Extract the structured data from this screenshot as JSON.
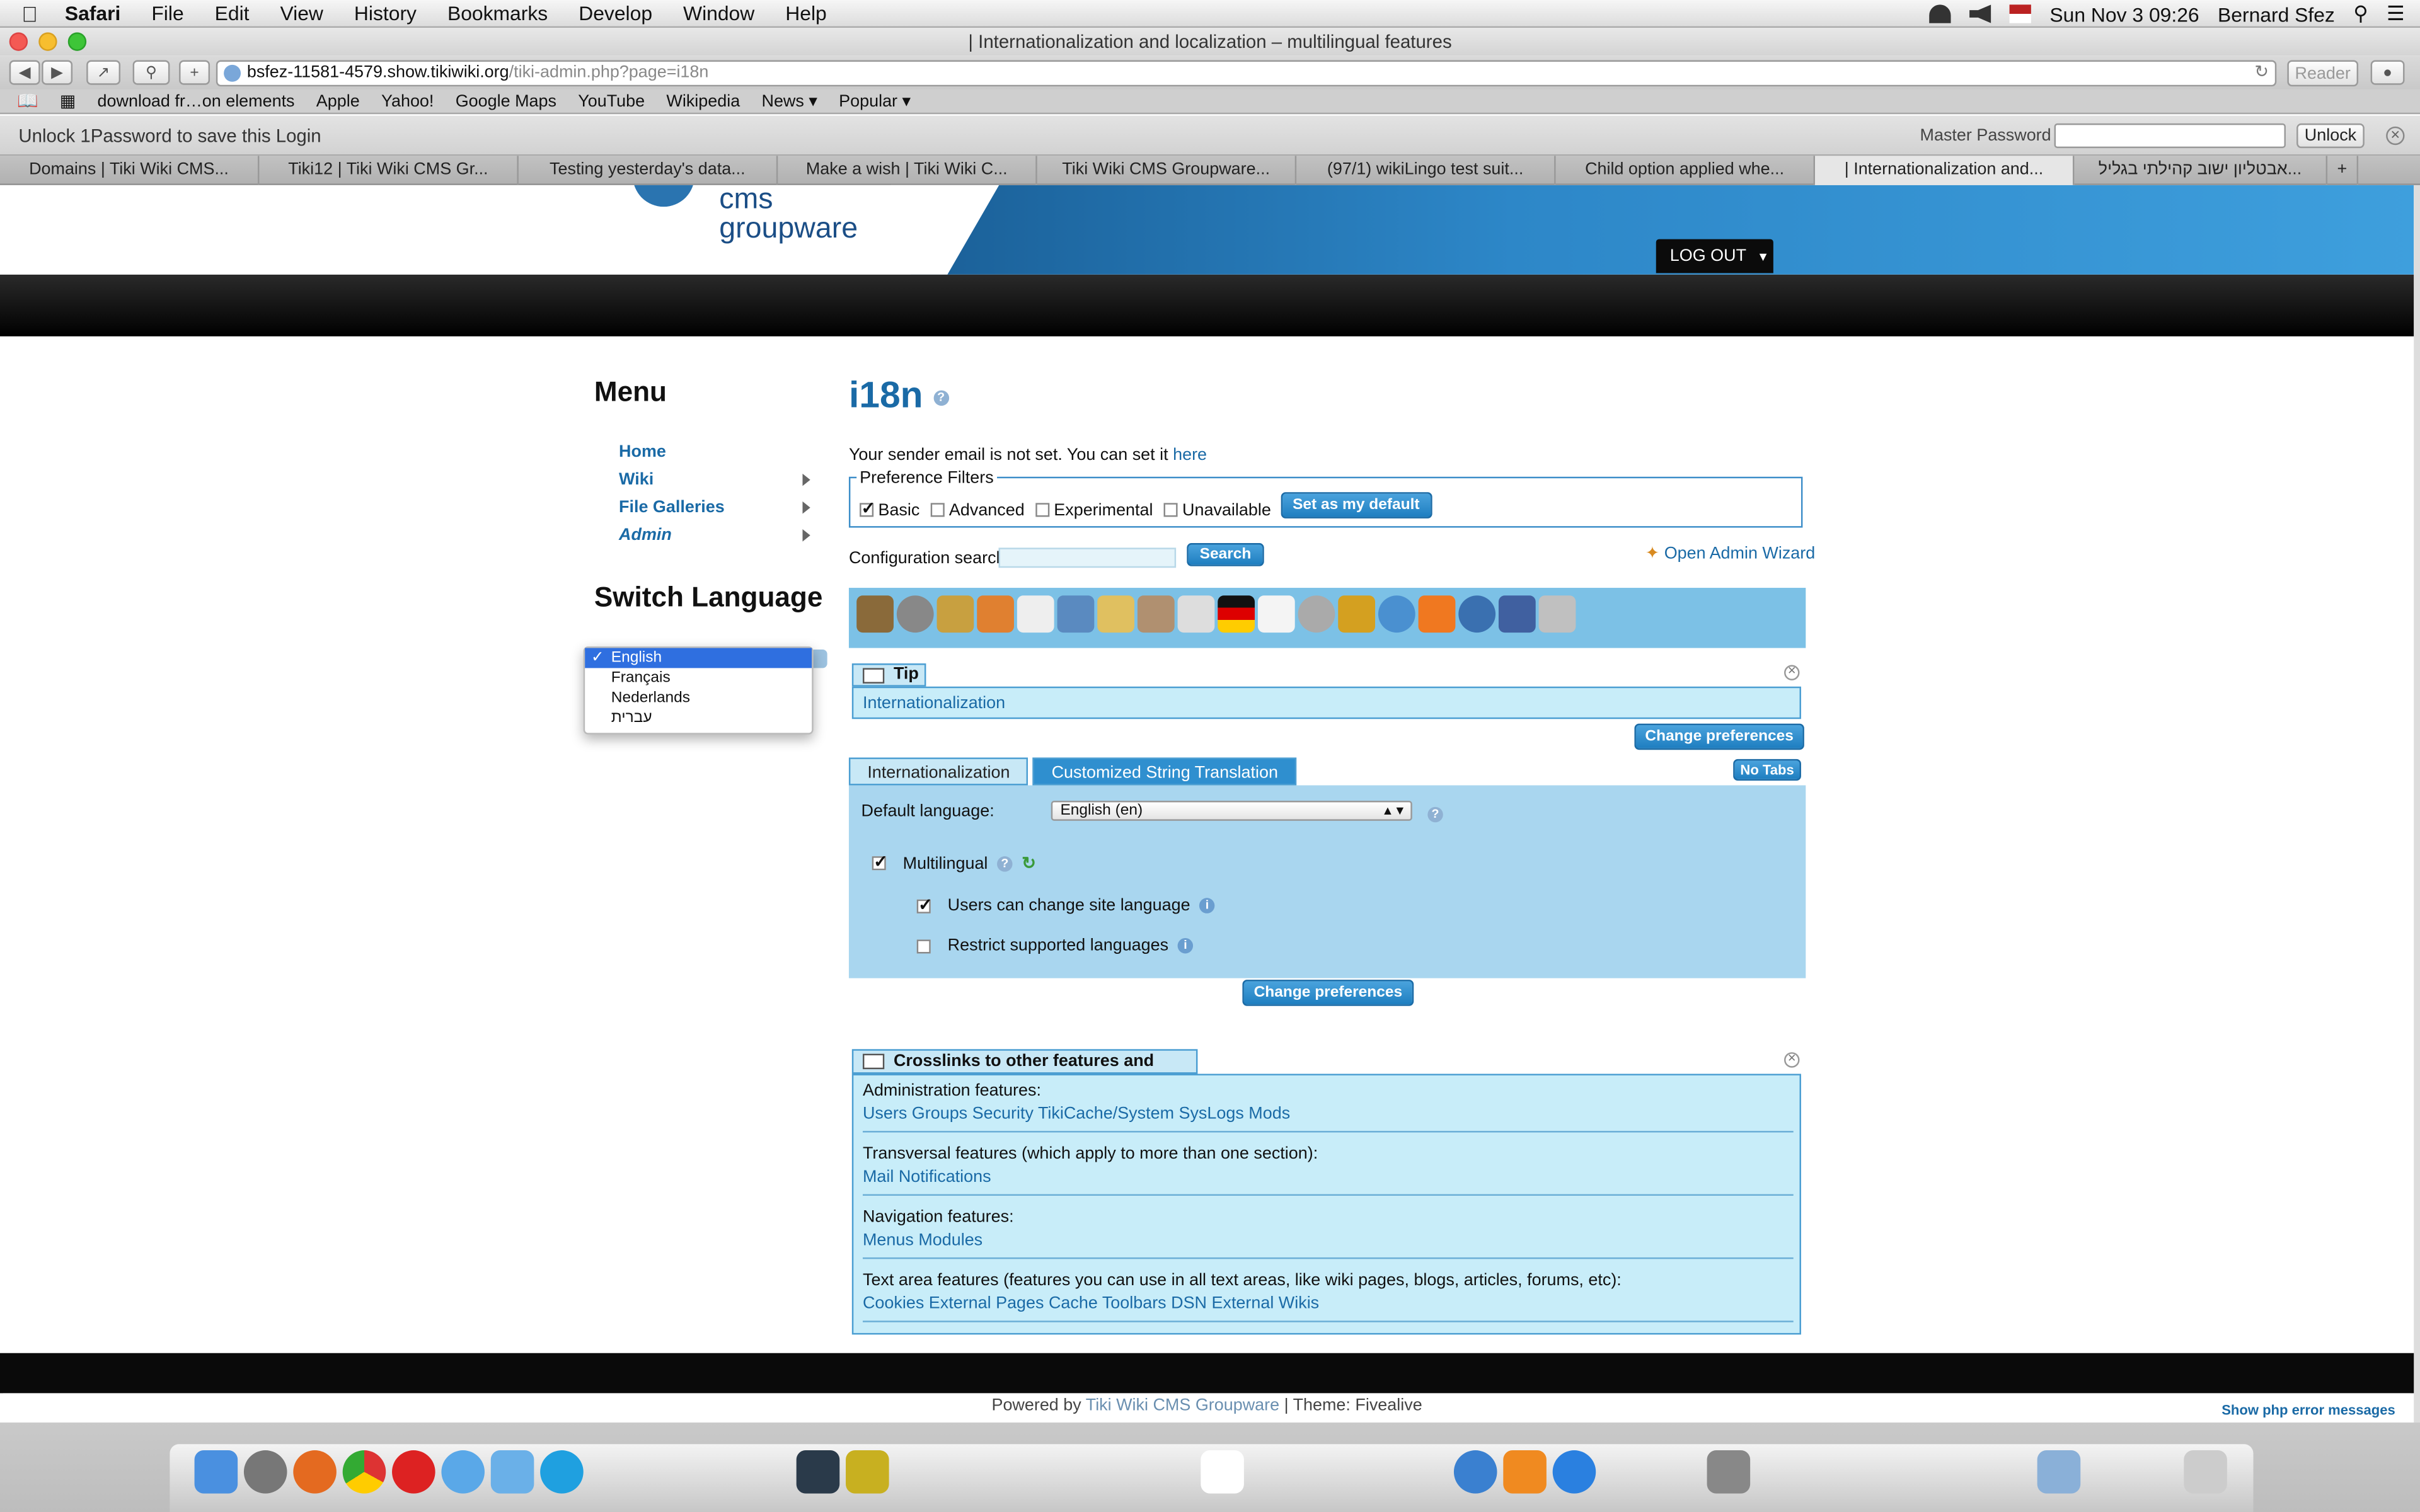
{
  "os_menubar": {
    "app_name": "Safari",
    "menus": [
      "File",
      "Edit",
      "View",
      "History",
      "Bookmarks",
      "Develop",
      "Window",
      "Help"
    ],
    "clock": "Sun Nov 3  09:26",
    "user": "Bernard Sfez"
  },
  "window": {
    "title": "| Internationalization and localization – multilingual features"
  },
  "toolbar": {
    "url_host": "bsfez-11581-4579.show.tikiwiki.org",
    "url_path": "/tiki-admin.php?page=i18n",
    "reader": "Reader"
  },
  "bookmarks": [
    "download fr…on elements",
    "Apple",
    "Yahoo!",
    "Google Maps",
    "YouTube",
    "Wikipedia",
    "News ▾",
    "Popular ▾"
  ],
  "onepassword": {
    "message": "Unlock 1Password to save this Login",
    "label": "Master Password",
    "unlock": "Unlock"
  },
  "tabs": [
    "Domains | Tiki Wiki CMS...",
    "Tiki12 | Tiki Wiki CMS Gr...",
    "Testing yesterday's data...",
    "Make a wish | Tiki Wiki C...",
    "Tiki Wiki CMS Groupware...",
    "(97/1) wikiLingo test suit...",
    "Child option applied whe...",
    "| Internationalization and...",
    "אבטליון ישוב קהילתי בגליל..."
  ],
  "site": {
    "logo_line1": "cms",
    "logo_line2": "groupware",
    "logout": "LOG OUT"
  },
  "menu": {
    "title": "Menu",
    "items": [
      "Home",
      "Wiki",
      "File Galleries",
      "Admin"
    ]
  },
  "switch_language": {
    "title": "Switch Language",
    "options": [
      "English",
      "Français",
      "Nederlands",
      "עברית"
    ],
    "selected": "English",
    "check": "✓"
  },
  "main": {
    "title": "i18n",
    "sender_text": "Your sender email is not set. You can set it ",
    "sender_link": "here",
    "filters": {
      "legend": "Preference Filters",
      "basic": "Basic",
      "advanced": "Advanced",
      "experimental": "Experimental",
      "unavailable": "Unavailable",
      "set_default": "Set as my default"
    },
    "config_search_label": "Configuration search:",
    "search_button": "Search",
    "wizard_link": "Open Admin Wizard",
    "tip": {
      "head": "Tip",
      "body": "Internationalization"
    },
    "change_prefs": "Change preferences",
    "tabs": [
      "Internationalization",
      "Customized String Translation"
    ],
    "no_tabs": "No Tabs",
    "default_language_label": "Default language:",
    "default_language_value": "English (en)",
    "multilingual": "Multilingual",
    "users_change_lang": "Users can change site language",
    "restrict_langs": "Restrict supported languages",
    "crosslinks": {
      "title": "Crosslinks to other features and settings",
      "admin_label": "Administration features:",
      "admin_links": "Users Groups Security TikiCache/System SysLogs Mods",
      "transversal_label": "Transversal features (which apply to more than one section):",
      "transversal_links": "Mail Notifications",
      "nav_label": "Navigation features:",
      "nav_links": "Menus Modules",
      "textarea_label": "Text area features (features you can use in all text areas, like wiki pages, blogs, articles, forums, etc):",
      "textarea_links": "Cookies External Pages Cache Toolbars DSN External Wikis"
    }
  },
  "footer": {
    "powered": "Powered by ",
    "tiki": "Tiki Wiki CMS Groupware",
    "theme": " | Theme: Fivealive",
    "php_errors": "Show php error messages"
  }
}
